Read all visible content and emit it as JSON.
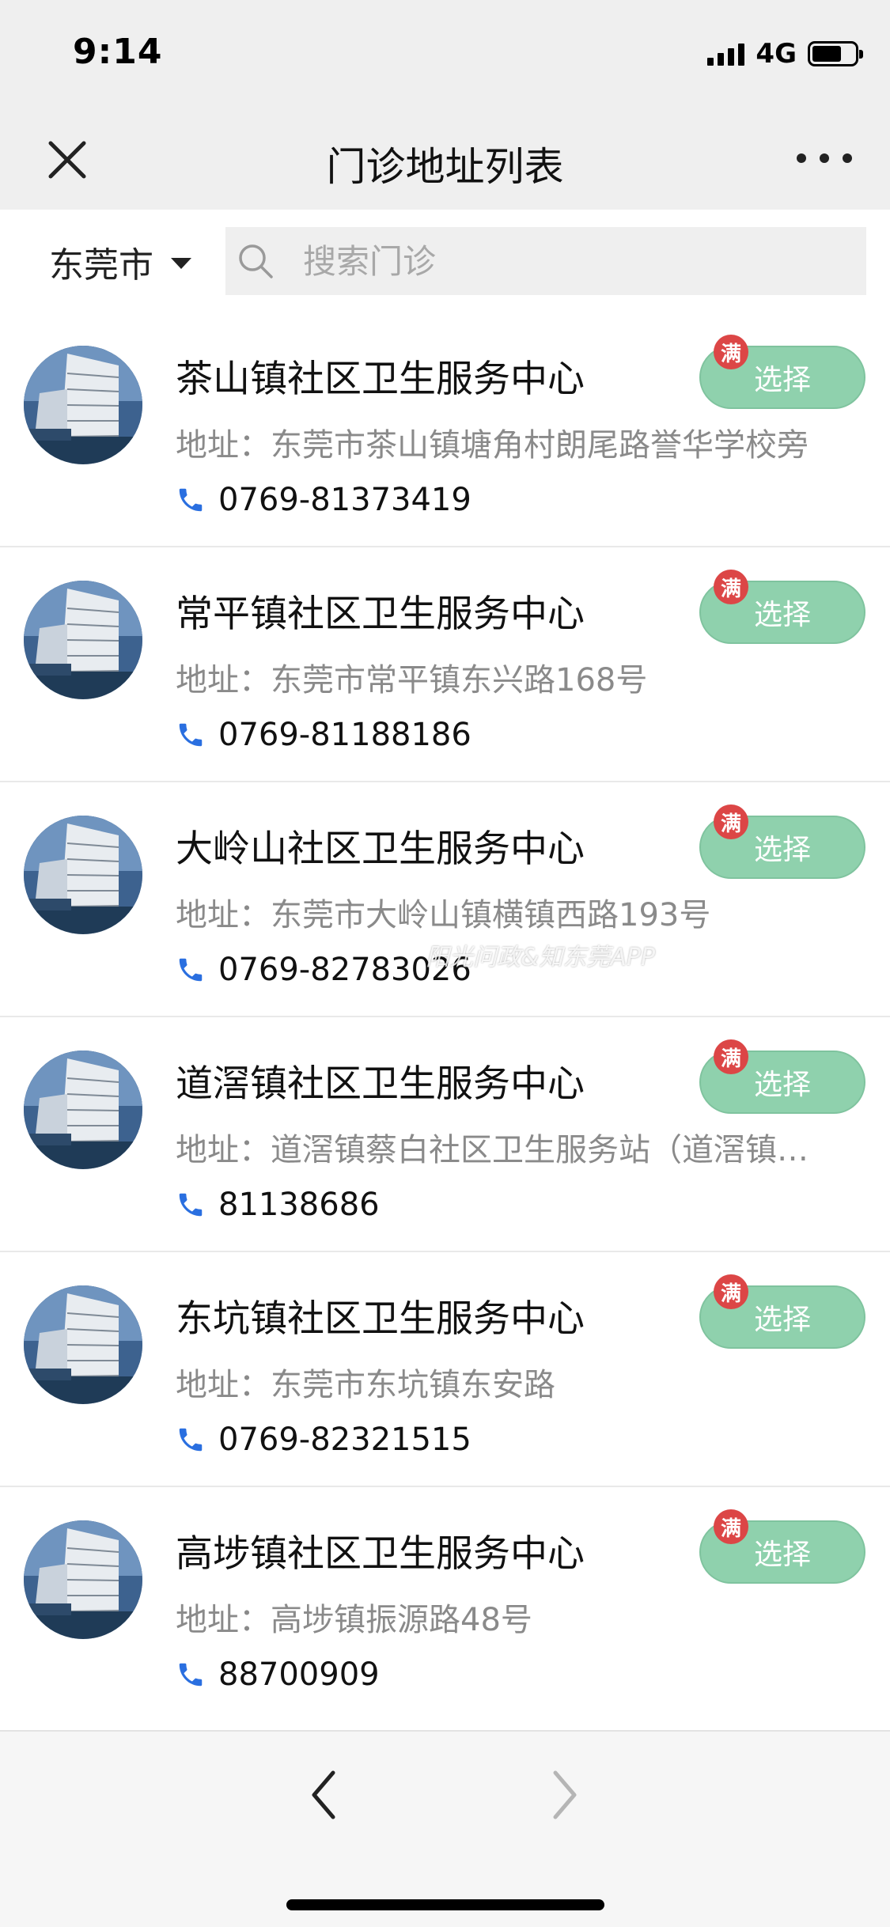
{
  "status_bar": {
    "time": "9:14",
    "network": "4G"
  },
  "nav": {
    "title": "门诊地址列表"
  },
  "filter": {
    "city": "东莞市",
    "search_placeholder": "搜索门诊"
  },
  "clinics": [
    {
      "name": "茶山镇社区卫生服务中心",
      "address": "地址：东莞市茶山镇塘角村朗尾路誉华学校旁",
      "phone": "0769-81373419",
      "badge": "满",
      "button": "选择"
    },
    {
      "name": "常平镇社区卫生服务中心",
      "address": "地址：东莞市常平镇东兴路168号",
      "phone": "0769-81188186",
      "badge": "满",
      "button": "选择"
    },
    {
      "name": "大岭山社区卫生服务中心",
      "address": "地址：东莞市大岭山镇横镇西路193号",
      "phone": "0769-82783026",
      "badge": "满",
      "button": "选择"
    },
    {
      "name": "道滘镇社区卫生服务中心",
      "address": "地址：道滘镇蔡白社区卫生服务站（道滘镇…",
      "phone": "81138686",
      "badge": "满",
      "button": "选择"
    },
    {
      "name": "东坑镇社区卫生服务中心",
      "address": "地址：东莞市东坑镇东安路",
      "phone": "0769-82321515",
      "badge": "满",
      "button": "选择"
    },
    {
      "name": "高埗镇社区卫生服务中心",
      "address": "地址：高埗镇振源路48号",
      "phone": "88700909",
      "badge": "满",
      "button": "选择"
    }
  ],
  "watermark": "阳光问政&知东莞APP",
  "colors": {
    "select_button": "#8fd1ad",
    "badge": "#dc4646",
    "phone_icon": "#2a6fe0",
    "nav_background": "#efefef"
  }
}
